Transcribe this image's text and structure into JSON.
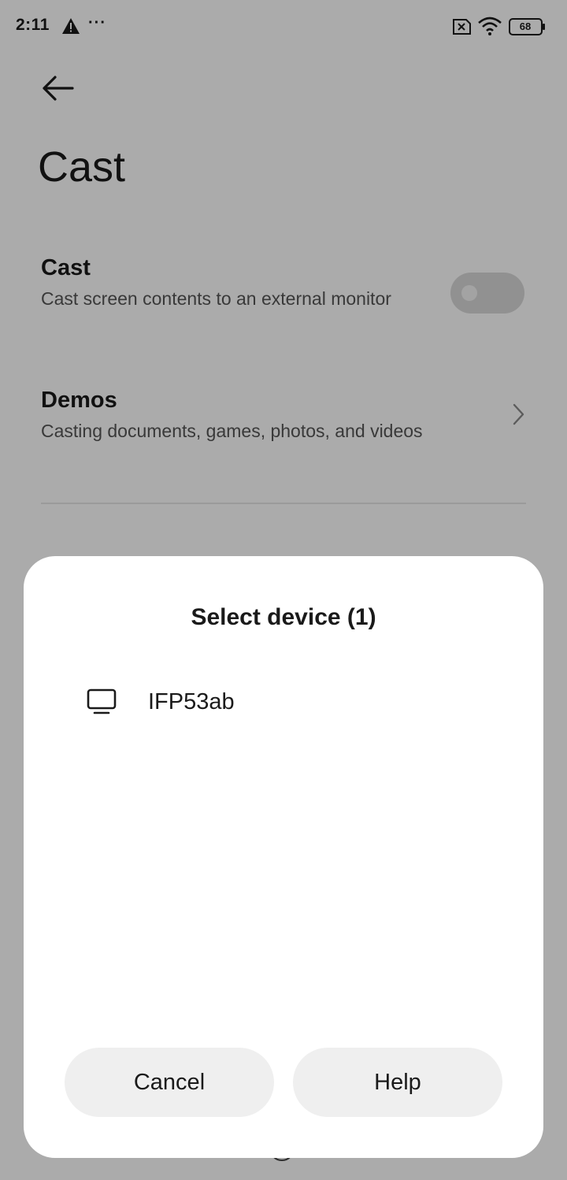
{
  "status_bar": {
    "time": "2:11",
    "more_indicator": "···",
    "battery_level": "68",
    "icons": [
      "warning-icon",
      "sim-icon",
      "wifi-icon",
      "battery-icon"
    ]
  },
  "header": {
    "title": "Cast",
    "back_icon": "back-arrow-icon"
  },
  "settings": {
    "cast": {
      "title": "Cast",
      "subtitle": "Cast screen contents to an external monitor",
      "toggle_on": false
    },
    "demos": {
      "title": "Demos",
      "subtitle": "Casting documents, games, photos, and videos",
      "icon": "chevron-right-icon"
    }
  },
  "dialog": {
    "title": "Select device (1)",
    "devices": [
      {
        "name": "IFP53ab",
        "icon": "monitor-icon"
      }
    ],
    "cancel_label": "Cancel",
    "help_label": "Help"
  },
  "navigation": {
    "icons": [
      "recents-icon",
      "home-icon",
      "back-icon"
    ]
  },
  "colors": {
    "scrim": "#a9a9a9",
    "dialog_background": "#ffffff",
    "button_background": "#efefef",
    "text_primary": "#1a1a1a",
    "text_secondary": "#555555"
  }
}
